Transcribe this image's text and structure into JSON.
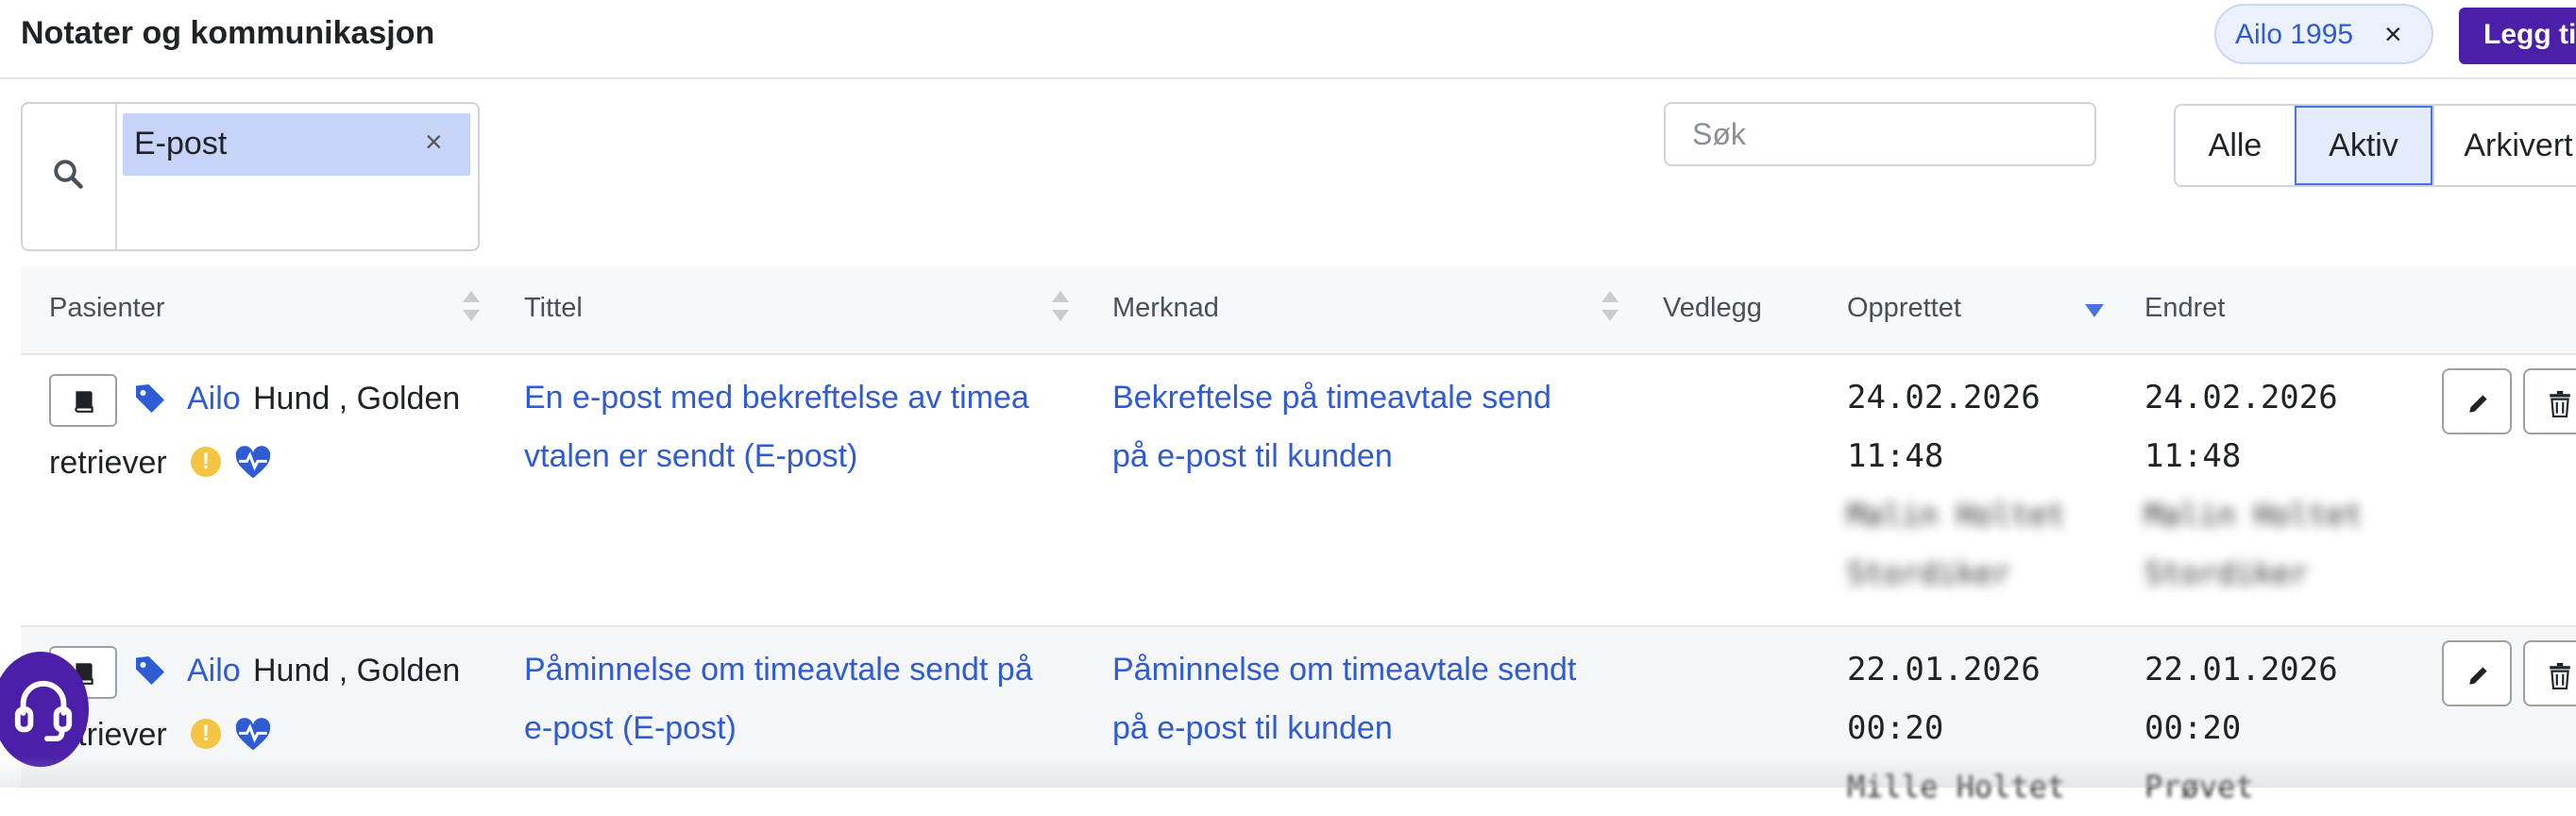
{
  "header": {
    "title": "Notater og kommunikasjon",
    "chip": {
      "label": "Ailo 1995",
      "close": "×"
    },
    "add_button_label": "Legg ti"
  },
  "filters": {
    "active_filter": {
      "label": "E-post",
      "close": "×"
    },
    "search_placeholder": "Søk",
    "status_options": [
      "Alle",
      "Aktiv",
      "Arkivert"
    ],
    "selected_status": "Aktiv"
  },
  "table": {
    "columns": [
      "Pasienter",
      "Tittel",
      "Merknad",
      "Vedlegg",
      "Opprettet",
      "Endret"
    ],
    "sorted_column": "Opprettet",
    "sort_direction": "descending",
    "rows": [
      {
        "patient_name": "Ailo",
        "patient_info_a": "Hund , Golden",
        "patient_info_b": "retriever",
        "title": [
          "En e-post med bekreftelse av timea",
          "vtalen er sendt (E-post)"
        ],
        "note": [
          "Bekreftelse på timeavtale send",
          "på e-post til kunden"
        ],
        "created": {
          "date": "24.02.2026",
          "time": "11:48",
          "user_line1": "Malin Holtet",
          "user_line2": "Stordiker"
        },
        "modified": {
          "date": "24.02.2026",
          "time": "11:48",
          "user_line1": "Malin Holtet",
          "user_line2": "Stordiker"
        }
      },
      {
        "patient_name": "Ailo",
        "patient_info_a": "Hund , Golden",
        "patient_info_b": "retriever",
        "title": [
          "Påminnelse om timeavtale sendt på",
          "e-post (E-post)"
        ],
        "note": [
          "Påminnelse om timeavtale sendt",
          "på e-post til kunden"
        ],
        "created": {
          "date": "22.01.2026",
          "time": "00:20",
          "user_line1": "Mille Holtet"
        },
        "modified": {
          "date": "22.01.2026",
          "time": "00:20",
          "user_line1": "Prøvet"
        }
      }
    ]
  },
  "icons": {
    "search": "search-icon",
    "book": "book-icon",
    "tag": "tag-icon",
    "warning": "warning-icon",
    "heart": "heart-pulse-icon",
    "edit": "pencil-icon",
    "delete": "trash-icon",
    "support": "headset-icon"
  },
  "colors": {
    "primary": "#4b1fa8",
    "link": "#2f5bd3",
    "filter_tag_bg": "#c7d4f7",
    "selected_segment_bg": "#e4ecfb",
    "warning": "#f4c542"
  }
}
